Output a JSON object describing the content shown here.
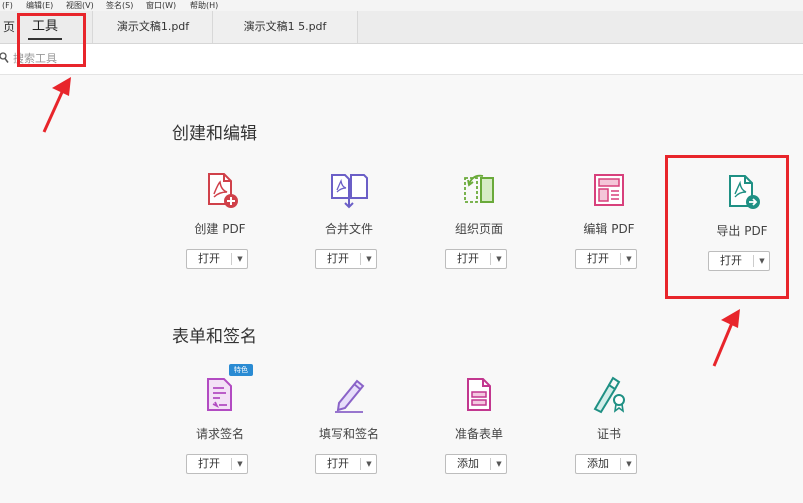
{
  "menubar": {
    "items": [
      "(F)",
      "编辑(E)",
      "视图(V)",
      "签名(S)",
      "窗口(W)",
      "帮助(H)"
    ]
  },
  "tabs": {
    "home": "页",
    "tools": "工具",
    "doc1": "演示文稿1.pdf",
    "doc2": "演示文稿1 5.pdf"
  },
  "search": {
    "placeholder": "搜索工具"
  },
  "sections": {
    "create_edit": {
      "title": "创建和编辑",
      "tools": [
        {
          "label": "创建 PDF",
          "button": "打开",
          "icon": "create-pdf-icon",
          "color": "#d0414a"
        },
        {
          "label": "合并文件",
          "button": "打开",
          "icon": "combine-files-icon",
          "color": "#6b5fc7"
        },
        {
          "label": "组织页面",
          "button": "打开",
          "icon": "organize-pages-icon",
          "color": "#6aaa3a"
        },
        {
          "label": "编辑 PDF",
          "button": "打开",
          "icon": "edit-pdf-icon",
          "color": "#d8407c"
        },
        {
          "label": "导出 PDF",
          "button": "打开",
          "icon": "export-pdf-icon",
          "color": "#1f9084"
        }
      ]
    },
    "forms_sign": {
      "title": "表单和签名",
      "badge": "特色",
      "tools": [
        {
          "label": "请求签名",
          "button": "打开",
          "icon": "request-signature-icon",
          "color": "#b24bc2"
        },
        {
          "label": "填写和签名",
          "button": "打开",
          "icon": "fill-sign-icon",
          "color": "#8a63c8"
        },
        {
          "label": "准备表单",
          "button": "添加",
          "icon": "prepare-form-icon",
          "color": "#c2378f"
        },
        {
          "label": "证书",
          "button": "添加",
          "icon": "certificate-icon",
          "color": "#1f9084"
        }
      ]
    }
  },
  "colors": {
    "highlight": "#e8252b",
    "badge": "#2a8bd3"
  }
}
